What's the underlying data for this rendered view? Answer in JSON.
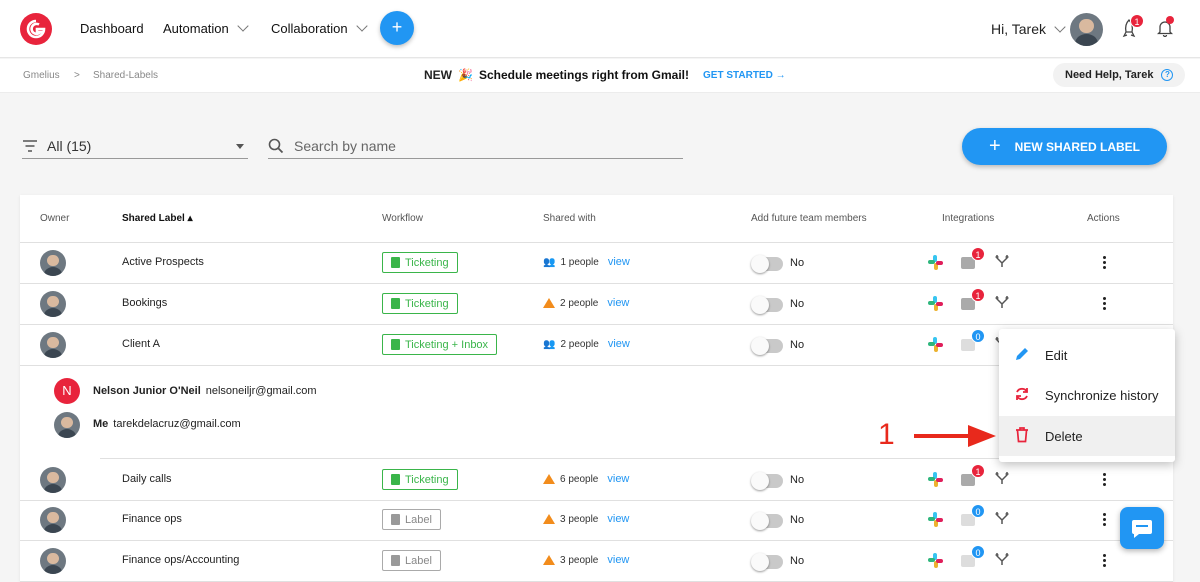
{
  "nav": {
    "dashboard": "Dashboard",
    "automation": "Automation",
    "collaboration": "Collaboration",
    "plus": "+",
    "greeting": "Hi, Tarek",
    "rocket_badge": "1"
  },
  "subbar": {
    "crumb1": "Gmelius",
    "crumb_sep": ">",
    "crumb2": "Shared-Labels",
    "promo_new": "NEW",
    "promo_emoji": "🎉",
    "promo_text": "Schedule meetings right from Gmail!",
    "promo_cta": "GET STARTED →",
    "help": "Need Help, Tarek",
    "help_icon": "?"
  },
  "filter": {
    "value": "All (15)",
    "search_placeholder": "Search by name"
  },
  "new_button": {
    "icon": "+",
    "label": "NEW SHARED LABEL"
  },
  "table": {
    "headers": {
      "owner": "Owner",
      "label": "Shared Label ▴",
      "workflow": "Workflow",
      "shared": "Shared with",
      "future": "Add future team members",
      "integrations": "Integrations",
      "actions": "Actions"
    },
    "rows": [
      {
        "label": "Active Prospects",
        "workflow": "Ticketing",
        "wf_type": "ticket",
        "people": "1 people",
        "warn": false,
        "view": "view",
        "toggle": "No",
        "badge": "1",
        "badge_color": "red"
      },
      {
        "label": "Bookings",
        "workflow": "Ticketing",
        "wf_type": "ticket",
        "people": "2 people",
        "warn": true,
        "view": "view",
        "toggle": "No",
        "badge": "1",
        "badge_color": "red"
      },
      {
        "label": "Client A",
        "workflow": "Ticketing + Inbox",
        "wf_type": "ticket",
        "people": "2 people",
        "warn": false,
        "view": "view",
        "toggle": "No",
        "badge": "0",
        "badge_color": "blue"
      },
      {
        "label": "Daily calls",
        "workflow": "Ticketing",
        "wf_type": "ticket",
        "people": "6 people",
        "warn": true,
        "view": "view",
        "toggle": "No",
        "badge": "1",
        "badge_color": "red"
      },
      {
        "label": "Finance ops",
        "workflow": "Label",
        "wf_type": "label",
        "people": "3 people",
        "warn": true,
        "view": "view",
        "toggle": "No",
        "badge": "0",
        "badge_color": "blue"
      },
      {
        "label": "Finance ops/Accounting",
        "workflow": "Label",
        "wf_type": "label",
        "people": "3 people",
        "warn": true,
        "view": "view",
        "toggle": "No",
        "badge": "0",
        "badge_color": "blue"
      }
    ],
    "members": [
      {
        "initial": "N",
        "name": "Nelson Junior O'Neil",
        "email": "nelsoneiljr@gmail.com"
      },
      {
        "initial": "",
        "name": "Me",
        "email": "tarekdelacruz@gmail.com"
      }
    ]
  },
  "menu": {
    "edit": "Edit",
    "sync": "Synchronize history",
    "delete": "Delete"
  },
  "annotation": {
    "number": "1"
  },
  "colors": {
    "accent": "#2196f3",
    "brand": "#e8243c",
    "success": "#3ab54a",
    "warning": "#f28c1c",
    "annotation": "#e8291c"
  }
}
